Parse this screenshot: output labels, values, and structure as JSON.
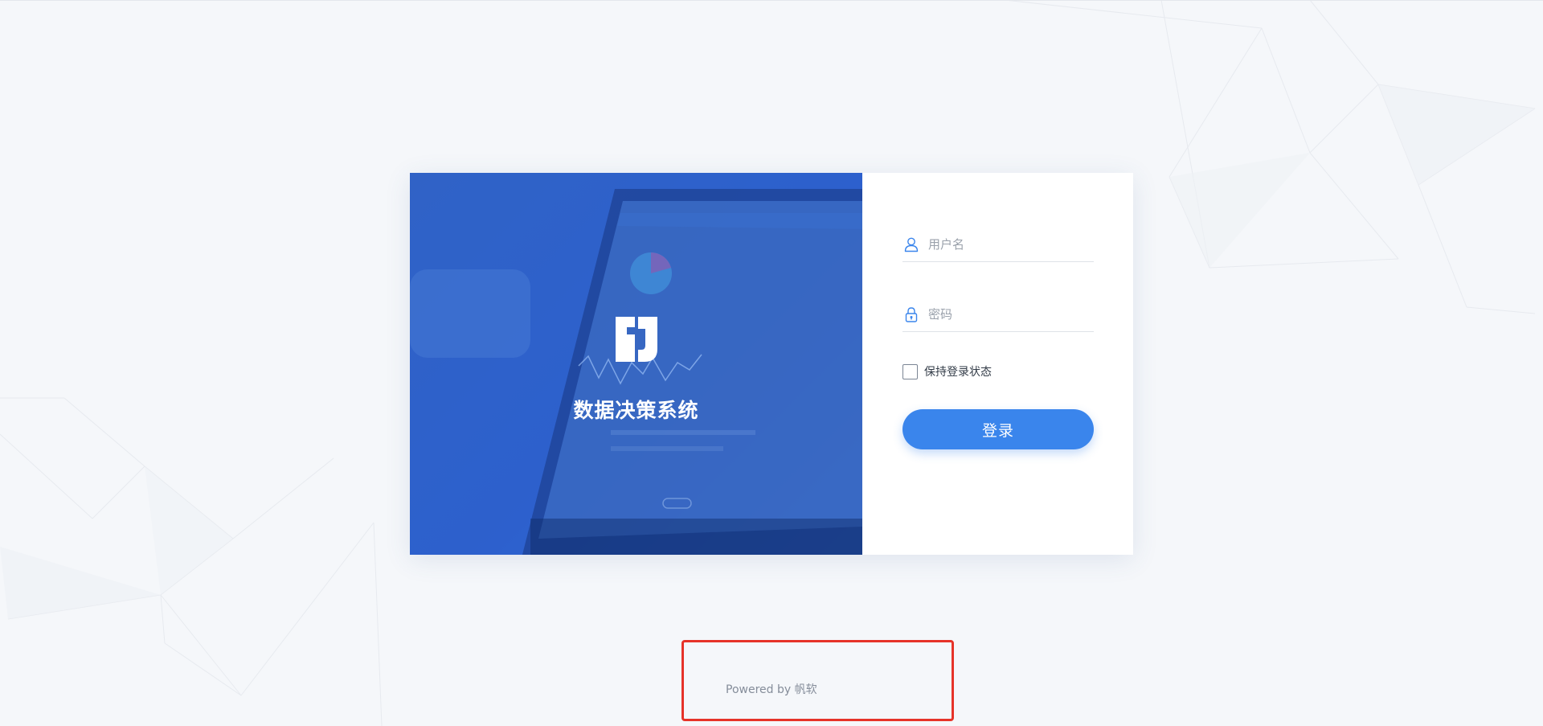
{
  "brand": {
    "title": "数据决策系统",
    "logo_icon": "fanruan-logo-icon"
  },
  "login_form": {
    "username": {
      "placeholder": "用户名",
      "value": "",
      "icon": "user-icon"
    },
    "password": {
      "placeholder": "密码",
      "value": "",
      "icon": "lock-icon"
    },
    "remember_label": "保持登录状态",
    "remember_checked": false,
    "submit_label": "登录"
  },
  "footer": {
    "text": "Powered by 帆软"
  },
  "colors": {
    "accent": "#3a85ec",
    "hero": "#3467c9",
    "page_background": "#f5f7fa",
    "highlight": "#e63329"
  }
}
